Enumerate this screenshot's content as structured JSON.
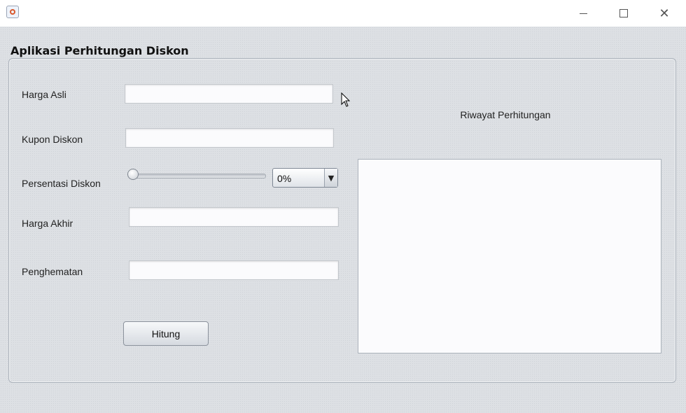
{
  "window": {
    "title": "",
    "controls": [
      "minimize-icon",
      "maximize-icon",
      "close-icon"
    ]
  },
  "panel": {
    "title": "Aplikasi Perhitungan Diskon"
  },
  "form": {
    "harga_asli": {
      "label": "Harga Asli",
      "value": ""
    },
    "kupon_diskon": {
      "label": "Kupon Diskon",
      "value": ""
    },
    "persentasi_diskon": {
      "label": "Persentasi Diskon",
      "slider_value": 0,
      "selected": "0%"
    },
    "harga_akhir": {
      "label": "Harga Akhir",
      "value": ""
    },
    "penghematan": {
      "label": "Penghematan",
      "value": ""
    },
    "hitung_label": "Hitung"
  },
  "history": {
    "title": "Riwayat Perhitungan",
    "content": ""
  }
}
